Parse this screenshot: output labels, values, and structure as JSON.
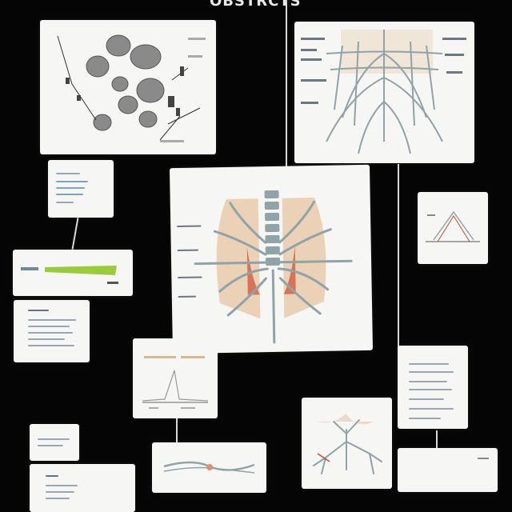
{
  "header": {
    "title": "OBSTRCTS"
  },
  "colors": {
    "background": "#050505",
    "card": "#f6f6f4",
    "connector": "#d8d8d8",
    "vessel": "#8fa3a8",
    "tissue": "#e8c9a8",
    "highlight": "#d04a2a",
    "accent_green": "#9acb3a"
  },
  "icons": {
    "nodules": "nodule-cluster-icon",
    "airway": "bronchial-tree-icon",
    "vertebra": "spine-icon"
  }
}
